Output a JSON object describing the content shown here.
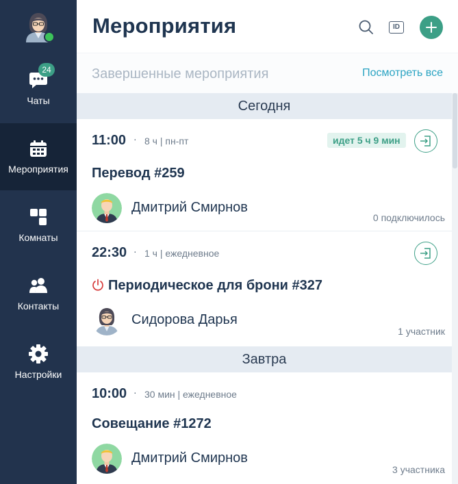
{
  "sidebar": {
    "items": [
      {
        "label": "Чаты",
        "icon": "chat-icon",
        "badge": "24"
      },
      {
        "label": "Мероприятия",
        "icon": "calendar-icon",
        "active": true
      },
      {
        "label": "Комнаты",
        "icon": "rooms-icon"
      },
      {
        "label": "Контакты",
        "icon": "contacts-icon"
      },
      {
        "label": "Настройки",
        "icon": "gear-icon"
      }
    ]
  },
  "header": {
    "title": "Мероприятия",
    "id_label": "ID"
  },
  "completed": {
    "title": "Завершенные мероприятия",
    "view_all": "Посмотреть все"
  },
  "days": [
    {
      "label": "Сегодня"
    },
    {
      "label": "Завтра"
    }
  ],
  "events": [
    {
      "time": "11:00",
      "meta": "8 ч | пн-пт",
      "status": "идет 5 ч 9 мин",
      "title": "Перевод #259",
      "person": "Дмитрий Смирнов",
      "count": "0 подключилось"
    },
    {
      "time": "22:30",
      "meta": "1 ч | ежедневное",
      "title": "Периодическое для брони #327",
      "person": "Сидорова Дарья",
      "count": "1 участник"
    },
    {
      "time": "10:00",
      "meta": "30 мин | ежедневное",
      "title": "Совещание #1272",
      "person": "Дмитрий Смирнов",
      "count": "3 участника"
    }
  ],
  "colors": {
    "sidebar": "#22334d",
    "sidebar_active": "#162438",
    "accent": "#3c9f86",
    "link": "#2aa3c2",
    "title": "#1f3550",
    "day_header": "#e5ebf2"
  }
}
